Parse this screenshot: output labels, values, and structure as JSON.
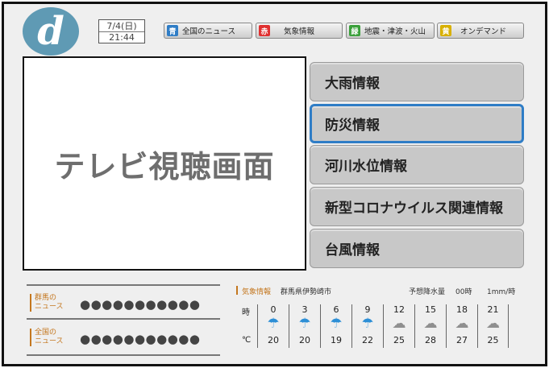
{
  "header": {
    "logo_letter": "d",
    "date": "7/4(日)",
    "time": "21:44"
  },
  "dbuttons": [
    {
      "key": "青",
      "label": "全国のニュース",
      "color": "#2f7dc6"
    },
    {
      "key": "赤",
      "label": "気象情報",
      "color": "#e03030"
    },
    {
      "key": "緑",
      "label": "地震・津波・火山",
      "color": "#3aa03a"
    },
    {
      "key": "黄",
      "label": "オンデマンド",
      "color": "#d8b000"
    }
  ],
  "tv_label": "テレビ視聴画面",
  "menu": [
    {
      "label": "大雨情報"
    },
    {
      "label": "防災情報"
    },
    {
      "label": "河川水位情報"
    },
    {
      "label": "新型コロナウイルス関連情報"
    },
    {
      "label": "台風情報"
    }
  ],
  "selected_menu_index": 1,
  "news": [
    {
      "label_line1": "群馬の",
      "label_line2": "ニュース",
      "text": "●●●●●●●●●●●"
    },
    {
      "label_line1": "全国の",
      "label_line2": "ニュース",
      "text": "●●●●●●●●●●●"
    }
  ],
  "weather": {
    "title": "気象情報",
    "location": "群馬県伊勢崎市",
    "precip_label": "予想降水量",
    "precip_value": "00時",
    "precip_unit": "1mm/時",
    "time_label": "時",
    "temp_label": "℃",
    "forecast": [
      {
        "hour": "0",
        "icon": "umbrella-icon",
        "temp": "20"
      },
      {
        "hour": "3",
        "icon": "umbrella-icon",
        "temp": "20"
      },
      {
        "hour": "6",
        "icon": "umbrella-icon",
        "temp": "19"
      },
      {
        "hour": "9",
        "icon": "umbrella-icon",
        "temp": "22"
      },
      {
        "hour": "12",
        "icon": "cloud-icon",
        "temp": "25"
      },
      {
        "hour": "15",
        "icon": "cloud-icon",
        "temp": "28"
      },
      {
        "hour": "18",
        "icon": "cloud-icon",
        "temp": "27"
      },
      {
        "hour": "21",
        "icon": "cloud-icon",
        "temp": "25"
      }
    ]
  }
}
